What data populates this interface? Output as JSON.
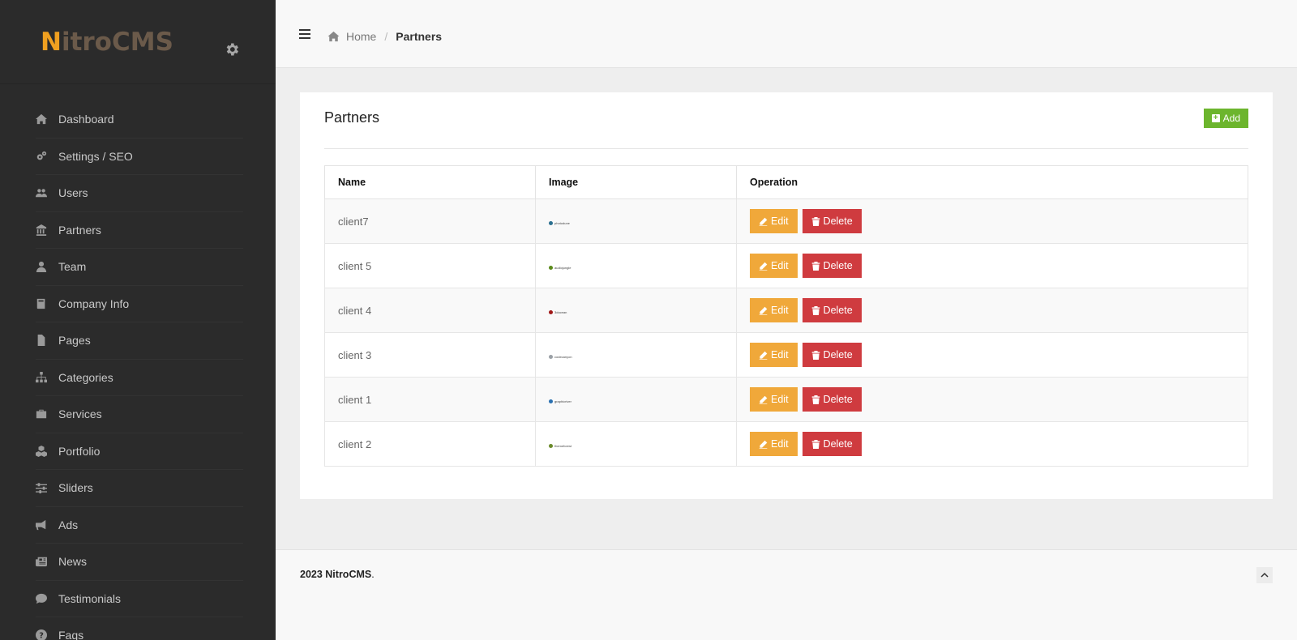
{
  "app": {
    "logo_first": "N",
    "logo_rest": "itroCMS"
  },
  "sidebar": {
    "items": [
      {
        "label": "Dashboard",
        "icon": "home-icon"
      },
      {
        "label": "Settings / SEO",
        "icon": "cogs-icon"
      },
      {
        "label": "Users",
        "icon": "users-icon"
      },
      {
        "label": "Partners",
        "icon": "bank-icon"
      },
      {
        "label": "Team",
        "icon": "user-icon"
      },
      {
        "label": "Company Info",
        "icon": "book-icon"
      },
      {
        "label": "Pages",
        "icon": "file-icon"
      },
      {
        "label": "Categories",
        "icon": "sitemap-icon"
      },
      {
        "label": "Services",
        "icon": "briefcase-icon"
      },
      {
        "label": "Portfolio",
        "icon": "cubes-icon"
      },
      {
        "label": "Sliders",
        "icon": "sliders-icon"
      },
      {
        "label": "Ads",
        "icon": "bullhorn-icon"
      },
      {
        "label": "News",
        "icon": "newspaper-icon"
      },
      {
        "label": "Testimonials",
        "icon": "comment-icon"
      },
      {
        "label": "Faqs",
        "icon": "question-icon"
      }
    ]
  },
  "breadcrumb": {
    "home": "Home",
    "separator": "/",
    "current": "Partners"
  },
  "panel": {
    "title": "Partners",
    "add_label": "Add",
    "columns": [
      "Name",
      "Image",
      "Operation"
    ],
    "edit_label": "Edit",
    "delete_label": "Delete",
    "rows": [
      {
        "name": "client7",
        "logo_text": "photodune",
        "logo_color": "#2a6f8f"
      },
      {
        "name": "client 5",
        "logo_text": "audiojungle",
        "logo_color": "#5a8a1a"
      },
      {
        "name": "client 4",
        "logo_text": "3docean",
        "logo_color": "#a01818"
      },
      {
        "name": "client 3",
        "logo_text": "codecanyon",
        "logo_color": "#9aa0a6"
      },
      {
        "name": "client 1",
        "logo_text": "graphicriver",
        "logo_color": "#2a70b0"
      },
      {
        "name": "client 2",
        "logo_text": "themeforest",
        "logo_color": "#6a8a2a"
      }
    ]
  },
  "footer": {
    "year_brand": "2023 NitroCMS",
    "suffix": "."
  },
  "colors": {
    "sidebar_bg": "#2b2b2b",
    "add": "#6cb52d",
    "edit": "#f0a83a",
    "delete": "#cf3b3f",
    "logo_accent": "#f0a020"
  }
}
